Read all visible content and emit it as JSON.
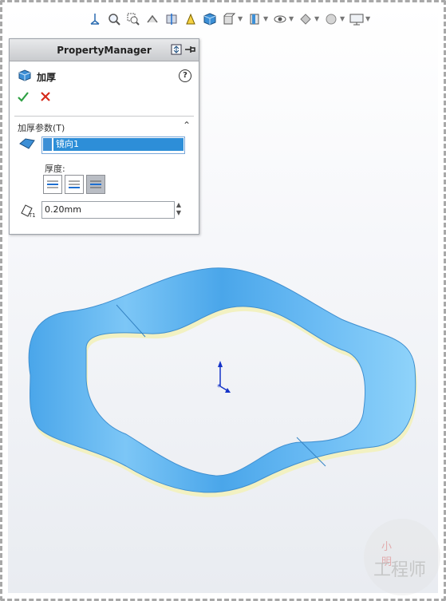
{
  "toolbar": {
    "icons": [
      "view-orientation-icon",
      "zoom-to-fit-icon",
      "zoom-area-icon",
      "previous-view-icon",
      "section-view-icon",
      "dynamic-annotation-icon",
      "view-cube-icon",
      "display-style-icon",
      "hide-show-icon",
      "appearance-icon",
      "scene-icon",
      "monitor-icon"
    ]
  },
  "property_manager": {
    "title": "PropertyManager",
    "feature_name": "加厚",
    "help_symbol": "?",
    "group": {
      "title": "加厚参数(T)",
      "selection_value": "镜向1",
      "thickness_label": "厚度:",
      "thickness_value": "0.20mm"
    }
  },
  "watermark": {
    "top": "小 明",
    "main": "工程师"
  },
  "colors": {
    "model_blue": "#5ab0ee",
    "model_edge_yellow": "#f2f1c2",
    "selection_blue": "#2d8ed8",
    "ok_green": "#2ea043",
    "cancel_red": "#d62a1a"
  }
}
